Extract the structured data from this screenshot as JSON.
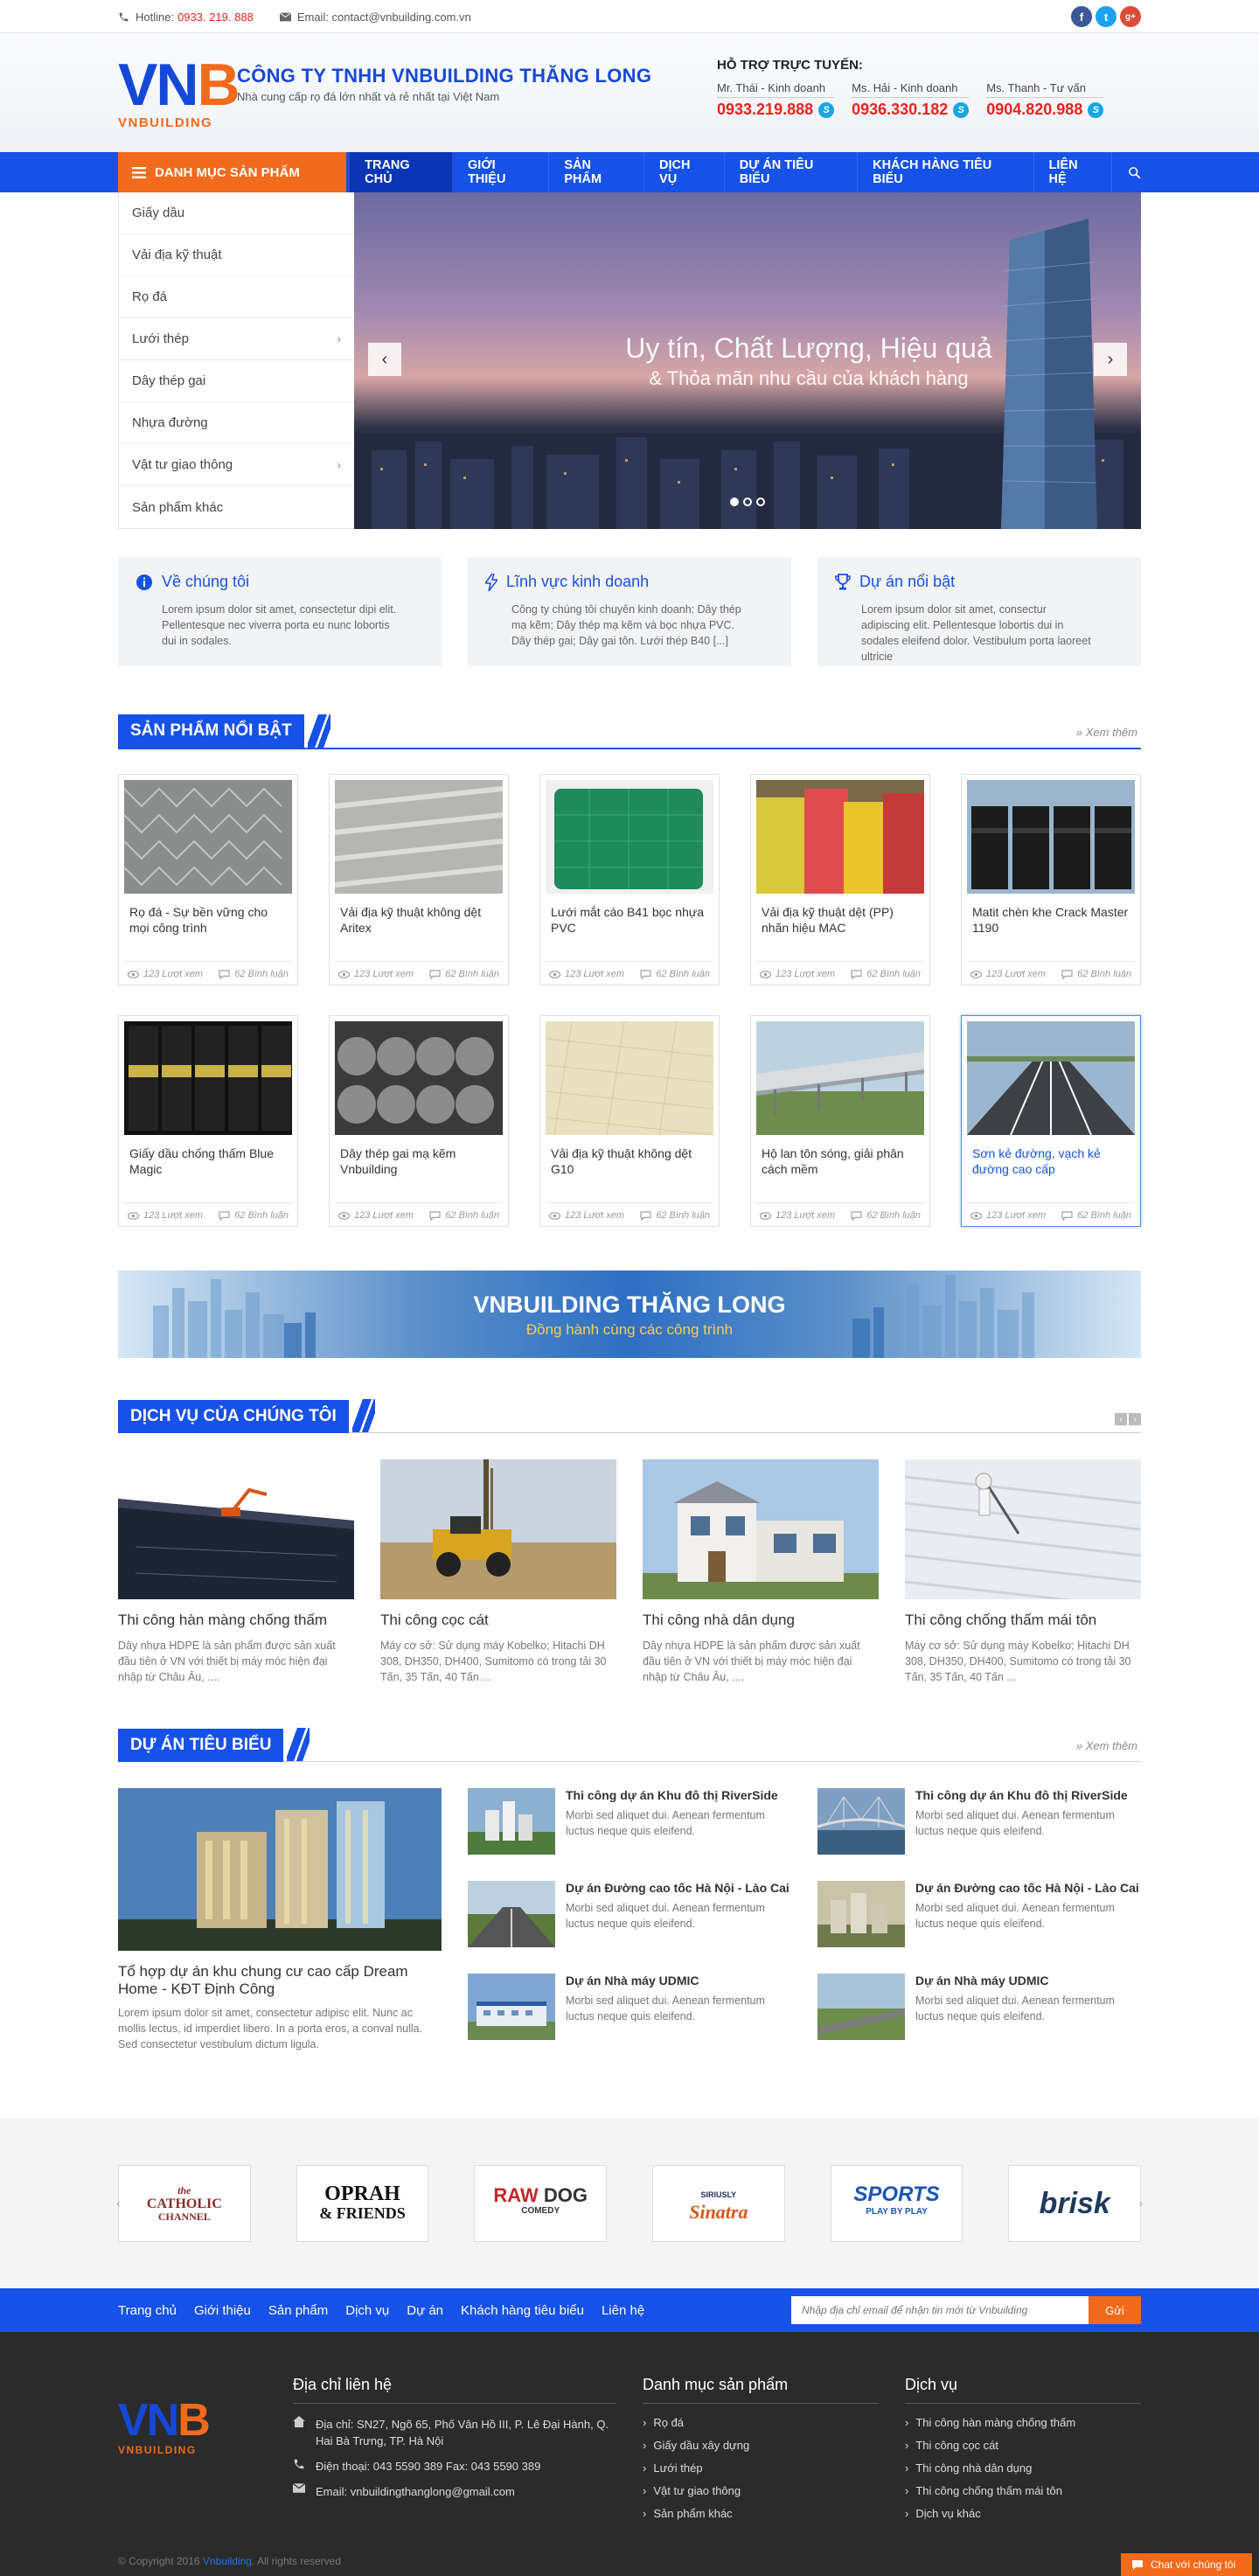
{
  "topbar": {
    "hotline_label": "Hotline:",
    "hotline_number": "0933. 219. 888",
    "email_label": "Email: contact@vnbuilding.com.vn",
    "socials": [
      "f",
      "t",
      "g+"
    ]
  },
  "header": {
    "logo_main": "VN",
    "logo_accent": "B",
    "logo_sub": "VNBUILDING",
    "company_name": "CÔNG TY TNHH VNBUILDING THĂNG LONG",
    "tagline": "Nhà cung cấp rọ đá lớn nhất và rẻ nhất tại Việt Nam",
    "support_title": "HỖ TRỢ TRỰC TUYẾN:",
    "hotlines": [
      {
        "name": "Mr. Thái - Kinh doanh",
        "phone": "0933.219.888"
      },
      {
        "name": "Ms. Hải - Kinh doanh",
        "phone": "0936.330.182"
      },
      {
        "name": "Ms. Thanh - Tư vấn",
        "phone": "0904.820.988"
      }
    ]
  },
  "nav": {
    "category_label": "DANH MỤC SẢN PHẨM",
    "items": [
      "TRANG CHỦ",
      "GIỚI THIỆU",
      "SẢN PHẨM",
      "DỊCH VỤ",
      "DỰ ÁN TIÊU BIỂU",
      "KHÁCH HÀNG TIÊU BIỂU",
      "LIÊN HỆ"
    ],
    "active": "TRANG CHỦ"
  },
  "categories": [
    "Giấy dầu",
    "Vải địa kỹ thuật",
    "Rọ đá",
    "Lưới thép",
    "Dây thép gai",
    "Nhựa đường",
    "Vật tư giao thông",
    "Sản phẩm khác"
  ],
  "slider": {
    "caption_main": "Uy tín, Chất Lượng, Hiệu quả",
    "caption_sub": "& Thỏa mãn nhu cầu của khách hàng"
  },
  "infos": [
    {
      "title": "Về chúng tôi",
      "text": "Lorem ipsum dolor sit amet, consectetur dipi elit. Pellentesque nec viverra porta eu nunc lobortis dui in sodales.",
      "icon": "info-icon"
    },
    {
      "title": "Lĩnh vực kinh doanh",
      "text": "Công ty chúng tôi chuyên kinh doanh: Dây thép mạ kẽm; Dây thép mạ kẽm và bọc nhựa PVC. Dây thép gai; Dây gai tôn. Lưới thép B40 [...]",
      "icon": "bolt-icon"
    },
    {
      "title": "Dự án nổi bật",
      "text": "Lorem ipsum dolor sit amet, consectur adipiscing elit. Pellentesque lobortis dui in sodales eleifend dolor. Vestibulum porta laoreet ultricie",
      "icon": "trophy-icon"
    }
  ],
  "featured": {
    "title": "SẢN PHẨM NỔI BẬT",
    "more": "Xem thêm",
    "products": [
      {
        "name": "Rọ đá - Sự bền vững cho mọi công trình",
        "views": "123 Lượt xem",
        "comments": "62 Bình luận"
      },
      {
        "name": "Vải địa kỹ thuật không dệt Aritex",
        "views": "123 Lượt xem",
        "comments": "62 Bình luận"
      },
      {
        "name": "Lưới mắt cáo B41 bọc nhựa PVC",
        "views": "123 Lượt xem",
        "comments": "62 Bình luận"
      },
      {
        "name": "Vải địa kỹ thuật dệt (PP) nhãn hiệu MAC",
        "views": "123 Lượt xem",
        "comments": "62 Bình luận"
      },
      {
        "name": "Matit chèn khe Crack Master 1190",
        "views": "123 Lượt xem",
        "comments": "62 Bình luận"
      },
      {
        "name": "Giấy dầu chống thấm Blue Magic",
        "views": "123 Lượt xem",
        "comments": "62 Bình luận"
      },
      {
        "name": "Dây thép gai mạ kẽm Vnbuilding",
        "views": "123 Lượt xem",
        "comments": "62 Bình luận"
      },
      {
        "name": "Vải địa kỹ thuật không dệt G10",
        "views": "123 Lượt xem",
        "comments": "62 Bình luận"
      },
      {
        "name": "Hộ lan tôn sóng, giải phân cách mềm",
        "views": "123 Lượt xem",
        "comments": "62 Bình luận"
      },
      {
        "name": "Sơn kẻ đường, vạch kẻ đường cao cấp",
        "views": "123 Lượt xem",
        "comments": "62 Bình luận"
      }
    ]
  },
  "banner": {
    "title": "VNBUILDING THĂNG LONG",
    "subtitle": "Đồng hành cùng các công trình"
  },
  "services": {
    "title": "DỊCH VỤ CỦA CHÚNG TÔI",
    "items": [
      {
        "title": "Thi công hàn màng chống thấm",
        "text": "Dây nhựa HDPE là sản phẩm được sản xuất đầu tiên ở VN với thiết bị máy móc hiện đại nhập từ Châu Âu, ...."
      },
      {
        "title": "Thi công cọc cát",
        "text": "Máy cơ sở: Sử dụng máy Kobelko; Hitachi DH 308, DH350, DH400, Sumitomo có trong tải 30 Tấn, 35 Tấn, 40 Tấn ..."
      },
      {
        "title": "Thi công nhà dân dụng",
        "text": "Dây nhựa HDPE là sản phẩm được sản xuất đầu tiên ở VN với thiết bị máy móc hiện đại nhập từ Châu Âu, ...."
      },
      {
        "title": "Thi công chống thấm mái tôn",
        "text": "Máy cơ sở: Sử dụng máy Kobelko; Hitachi DH 308, DH350, DH400, Sumitomo có trong tải 30 Tấn, 35 Tấn, 40 Tấn ..."
      }
    ]
  },
  "projects": {
    "title": "DỰ ÁN TIÊU BIỂU",
    "more": "Xem thêm",
    "main": {
      "title": "Tổ hợp dự án khu chung cư cao cấp Dream Home - KĐT Định Công",
      "text": "Lorem ipsum dolor sit amet, consectetur adipisc elit. Nunc ac mollis lectus, id imperdiet libero. In a porta eros, a conval nulla. Sed consectetur vestibulum dictum ligula."
    },
    "list_left": [
      {
        "title": "Thi công dự án Khu đô thị RiverSide",
        "text": "Morbi sed aliquet dui. Aenean fermentum luctus neque quis eleifend."
      },
      {
        "title": "Dự án Đường cao tốc Hà Nội - Lào Cai",
        "text": "Morbi sed aliquet dui. Aenean fermentum luctus neque quis eleifend."
      },
      {
        "title": "Dự án Nhà máy UDMIC",
        "text": "Morbi sed aliquet dui. Aenean fermentum luctus neque quis eleifend."
      }
    ],
    "list_right": [
      {
        "title": "Thi công dự án Khu đô thị RiverSide",
        "text": "Morbi sed aliquet dui. Aenean fermentum luctus neque quis eleifend."
      },
      {
        "title": "Dự án Đường cao tốc Hà Nội - Lào Cai",
        "text": "Morbi sed aliquet dui. Aenean fermentum luctus neque quis eleifend."
      },
      {
        "title": "Dự án Nhà máy UDMIC",
        "text": "Morbi sed aliquet dui. Aenean fermentum luctus neque quis eleifend."
      }
    ]
  },
  "partners": [
    {
      "line1": "the",
      "line2": "CATHOLIC",
      "line3": "CHANNEL"
    },
    {
      "line1": "OPRAH",
      "line2": "& FRIENDS",
      "line3": ""
    },
    {
      "line1": "RAW",
      "line2": "DOG",
      "line3": "COMEDY"
    },
    {
      "line1": "SIRIUSLY",
      "line2": "Sinatra",
      "line3": ""
    },
    {
      "line1": "SPORTS",
      "line2": "PLAY BY PLAY",
      "line3": ""
    },
    {
      "line1": "brisk",
      "line2": "",
      "line3": ""
    }
  ],
  "footer_nav": {
    "links": [
      "Trang chủ",
      "Giới thiệu",
      "Sản phẩm",
      "Dịch vụ",
      "Dự án",
      "Khách hàng tiêu biểu",
      "Liên hệ"
    ],
    "subscribe_placeholder": "Nhập địa chỉ email để nhận tin mới từ Vnbuilding",
    "subscribe_button": "Gửi"
  },
  "footer": {
    "contact_title": "Địa chỉ liên hệ",
    "address": "Địa chỉ: SN27, Ngõ 65, Phố Vân Hồ III, P. Lê Đại Hành, Q. Hai Bà Trưng, TP. Hà Nội",
    "phone": "Điện thoại: 043 5590 389 Fax: 043 5590 389",
    "email": "Email: vnbuildingthanglong@gmail.com",
    "products_title": "Danh mục sản phẩm",
    "products": [
      "Rọ đá",
      "Giấy dầu xây dựng",
      "Lưới thép",
      "Vật tư giao thông",
      "Sản phẩm khác"
    ],
    "services_title": "Dịch vụ",
    "services": [
      "Thi công hàn màng chống thấm",
      "Thi công cọc cát",
      "Thi công nhà dân dụng",
      "Thi công chống thấm mái tôn",
      "Dịch vụ khác"
    ],
    "copyright_pre": "© Copyright 2016",
    "copyright_brand": "Vnbuilding",
    "copyright_post": ". All rights reserved",
    "chat_label": "Chat với chúng tôi"
  },
  "colors": {
    "primary": "#1651e8",
    "accent": "#f26a1b",
    "red": "#e8231e"
  }
}
